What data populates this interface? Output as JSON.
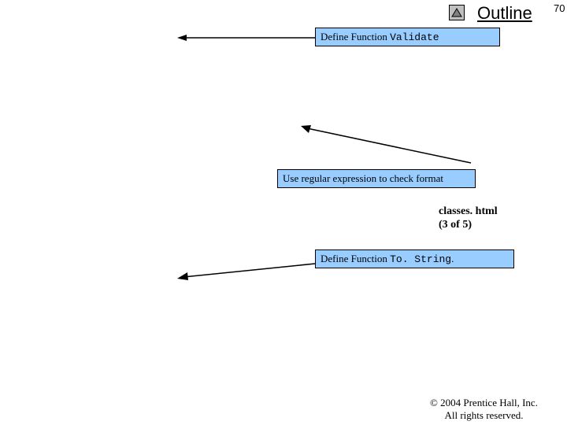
{
  "header": {
    "outline_label": "Outline",
    "page_number": "70"
  },
  "callouts": {
    "c1_prefix": "Define Function ",
    "c1_code": "Validate",
    "c2_text": "Use regular expression to check format",
    "c3_prefix": "Define Function ",
    "c3_code": "To. String",
    "c3_suffix": "."
  },
  "file": {
    "name": "classes. html",
    "part": "(3 of 5)"
  },
  "footer": {
    "copyright_line1": "© 2004 Prentice Hall, Inc.",
    "copyright_line2": "All rights reserved."
  }
}
